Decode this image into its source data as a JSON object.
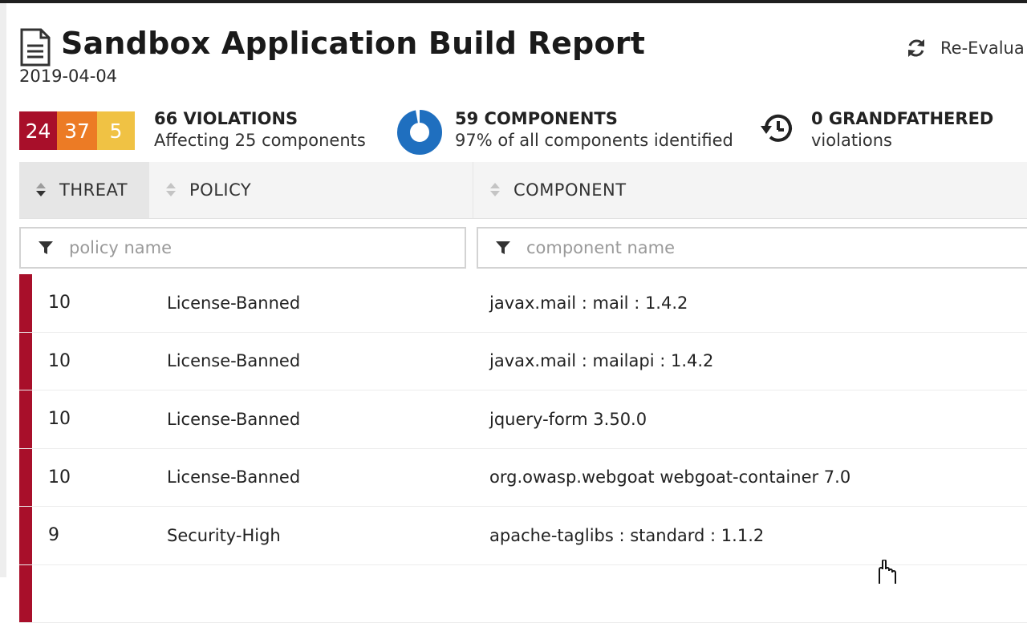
{
  "header": {
    "title": "Sandbox Application Build Report",
    "date": "2019-04-04",
    "reevaluate_label": "Re-Evalua"
  },
  "summary": {
    "counts": {
      "critical": "24",
      "severe": "37",
      "moderate": "5"
    },
    "violations_title": "66 VIOLATIONS",
    "violations_sub": "Affecting 25 components",
    "components_title": "59 COMPONENTS",
    "components_sub": "97% of all components identified",
    "components_identified_fraction": 0.97,
    "grandfathered_title": "0 GRANDFATHERED",
    "grandfathered_sub": "violations"
  },
  "table": {
    "columns": {
      "threat": "THREAT",
      "policy": "POLICY",
      "component": "COMPONENT"
    },
    "filters": {
      "policy_placeholder": "policy name",
      "component_placeholder": "component name"
    },
    "rows": [
      {
        "threat": "10",
        "policy": "License-Banned",
        "component": "javax.mail : mail : 1.4.2"
      },
      {
        "threat": "10",
        "policy": "License-Banned",
        "component": "javax.mail : mailapi : 1.4.2"
      },
      {
        "threat": "10",
        "policy": "License-Banned",
        "component": "jquery-form 3.50.0"
      },
      {
        "threat": "10",
        "policy": "License-Banned",
        "component": "org.owasp.webgoat webgoat-container 7.0"
      },
      {
        "threat": "9",
        "policy": "Security-High",
        "component": "apache-taglibs : standard : 1.1.2"
      }
    ]
  },
  "colors": {
    "critical": "#a80f2a",
    "severe": "#ec7b25",
    "moderate": "#f0c244",
    "donut": "#1f6fbf"
  },
  "icons": {
    "report": "document-icon",
    "reevaluate": "refresh-icon",
    "grandfathered": "history-icon",
    "filter": "funnel-icon",
    "sort": "sort-icon"
  }
}
